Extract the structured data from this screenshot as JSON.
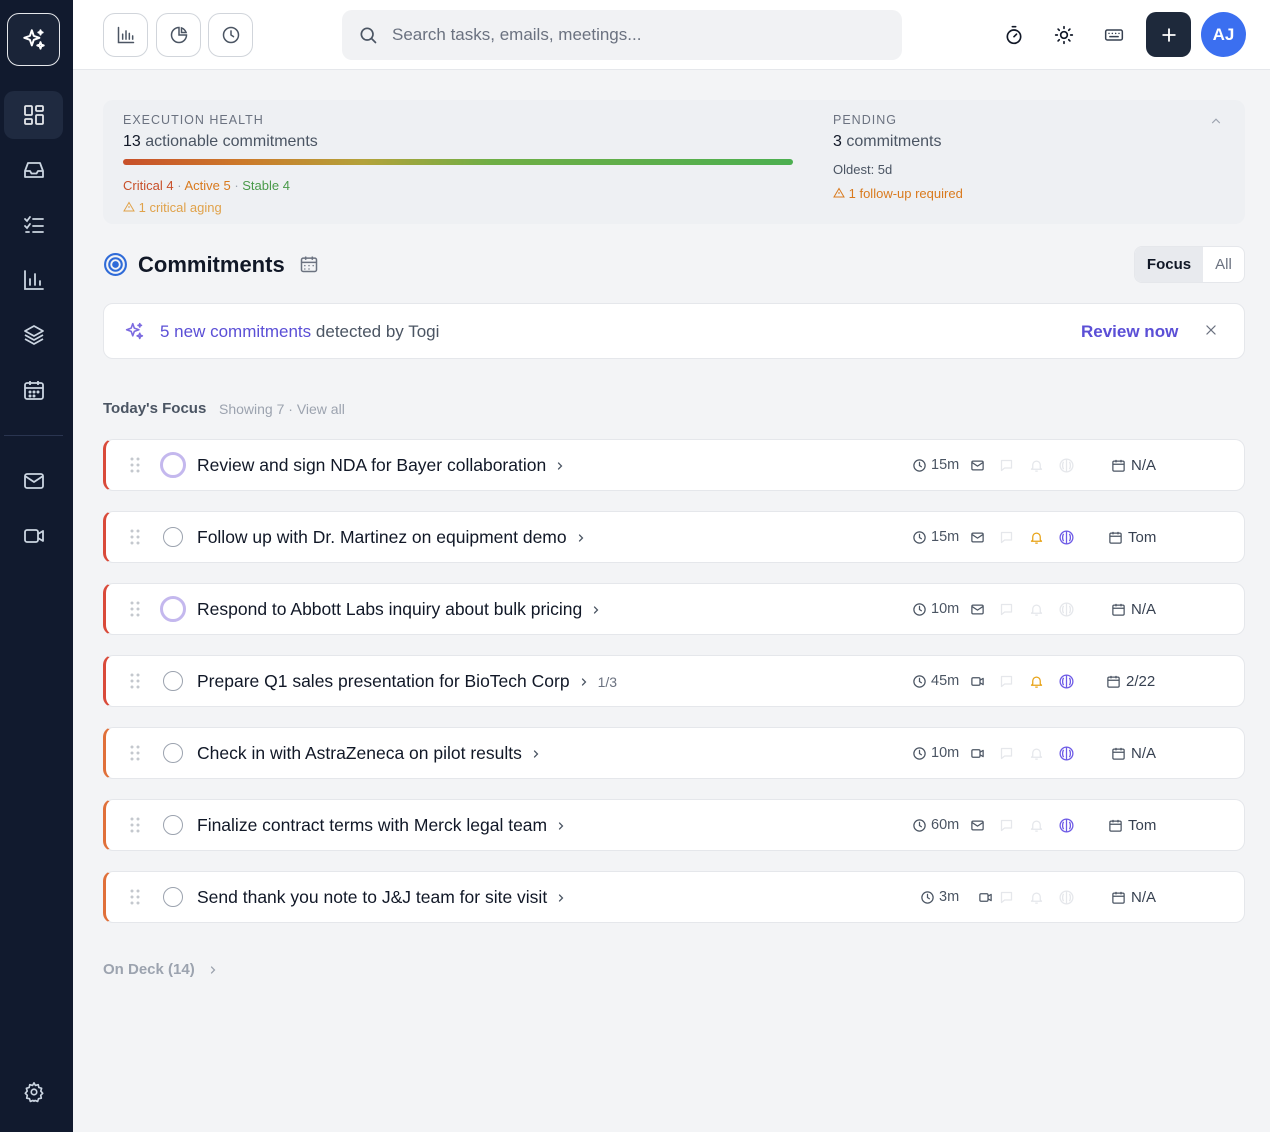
{
  "topbar": {
    "search_placeholder": "Search tasks, emails, meetings...",
    "avatar_initials": "AJ"
  },
  "health": {
    "label": "EXECUTION HEALTH",
    "count": "13",
    "count_suffix": "actionable commitments",
    "critical": "Critical 4",
    "active": "Active 5",
    "stable": "Stable 4",
    "aging": "1 critical aging",
    "pending_label": "PENDING",
    "pending_count": "3",
    "pending_suffix": "commitments",
    "oldest": "Oldest: 5d",
    "followup": "1 follow-up required",
    "colors": {
      "critical": "#c8502a",
      "active": "#d97a1e",
      "stable": "#4a9a4a"
    }
  },
  "commitments": {
    "title": "Commitments",
    "toggle_focus": "Focus",
    "toggle_all": "All"
  },
  "banner": {
    "highlight": "5 new commitments",
    "text": "detected by Togi",
    "action": "Review now"
  },
  "focus": {
    "title": "Today's Focus",
    "showing": "Showing 7 · View all"
  },
  "tasks": [
    {
      "title": "Review and sign NDA for Bayer collaboration",
      "sub": "",
      "time": "15m",
      "channel": "mail",
      "bell": false,
      "brain": false,
      "owner": "N/A"
    },
    {
      "title": "Follow up with Dr. Martinez on equipment demo",
      "sub": "",
      "time": "15m",
      "channel": "mail",
      "bell": true,
      "brain": true,
      "owner": "Tom"
    },
    {
      "title": "Respond to Abbott Labs inquiry about bulk pricing",
      "sub": "",
      "time": "10m",
      "channel": "mail",
      "bell": false,
      "brain": false,
      "owner": "N/A"
    },
    {
      "title": "Prepare Q1 sales presentation for BioTech Corp",
      "sub": "1/3",
      "time": "45m",
      "channel": "video",
      "bell": true,
      "brain": true,
      "owner": "2/22"
    },
    {
      "title": "Check in with AstraZeneca on pilot results",
      "sub": "",
      "time": "10m",
      "channel": "video",
      "bell": false,
      "brain": true,
      "owner": "N/A"
    },
    {
      "title": "Finalize contract terms with Merck legal team",
      "sub": "",
      "time": "60m",
      "channel": "mail",
      "bell": false,
      "brain": true,
      "owner": "Tom"
    },
    {
      "title": "Send thank you note to J&J team for site visit",
      "sub": "",
      "time": "3m",
      "channel": "video",
      "bell": false,
      "brain": false,
      "owner": "N/A"
    }
  ],
  "ondeck": {
    "label": "On Deck (14)"
  }
}
